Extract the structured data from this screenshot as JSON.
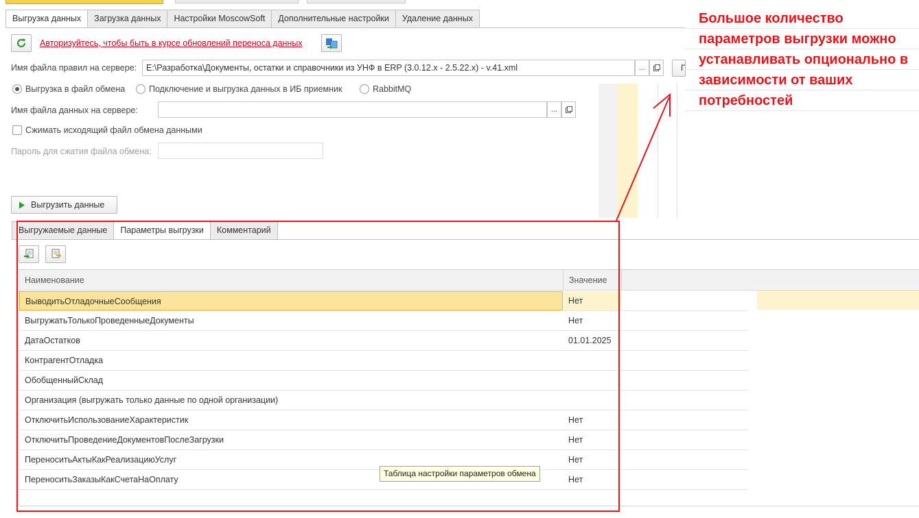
{
  "main_tabs": [
    {
      "label": "Выгрузка данных",
      "active": true
    },
    {
      "label": "Загрузка данных",
      "active": false
    },
    {
      "label": "Настройки MoscowSoft",
      "active": false
    },
    {
      "label": "Дополнительные настройки",
      "active": false
    },
    {
      "label": "Удаление данных",
      "active": false
    }
  ],
  "toolbar": {
    "refresh_icon": "refresh-icon",
    "auth_link": "Авторизуйтесь, чтобы быть в курсе обновлений переноса данных",
    "info_icon": "transfer-icon"
  },
  "rules_file": {
    "label": "Имя файла правил на сервере:",
    "value": "E:\\Разработка\\Документы, остатки и справочники из УНФ в ERP (3.0.12.x - 2.5.22.x) - v.41.xml",
    "browse": "...",
    "extra_button": "П"
  },
  "mode_radios": [
    {
      "label": "Выгрузка в файл обмена",
      "selected": true
    },
    {
      "label": "Подключение и выгрузка данных в ИБ приемник",
      "selected": false
    },
    {
      "label": "RabbitMQ",
      "selected": false
    }
  ],
  "data_file": {
    "label": "Имя файла данных на сервере:",
    "value": "",
    "browse": "..."
  },
  "compress": {
    "label": "Сжимать исходящий файл обмена данными",
    "checked": false
  },
  "password": {
    "label": "Пароль для сжатия файла обмена:",
    "value": ""
  },
  "export_button": "Выгрузить данные",
  "annotation": {
    "lines": [
      "Большое количество",
      "параметров выгрузки можно",
      "устанавливать опционально в",
      "зависимости от ваших",
      "потребностей"
    ],
    "color": "#e8141a"
  },
  "sub_tabs": [
    {
      "label": "Выгружаемые данные",
      "active": false
    },
    {
      "label": "Параметры выгрузки",
      "active": true
    },
    {
      "label": "Комментарий",
      "active": false
    }
  ],
  "params_toolbar": [
    "load-params-icon",
    "save-params-icon"
  ],
  "table": {
    "headers": [
      "Наименование",
      "Значение"
    ],
    "rows": [
      {
        "name": "ВыводитьОтладочныеСообщения",
        "value": "Нет",
        "selected": true
      },
      {
        "name": "ВыгружатьТолькоПроведенныеДокументы",
        "value": "Нет"
      },
      {
        "name": "ДатаОстатков",
        "value": "01.01.2025"
      },
      {
        "name": "КонтрагентОтладка",
        "value": ""
      },
      {
        "name": "ОбобщенныйСклад",
        "value": ""
      },
      {
        "name": "Организация (выгружать только данные по одной организации)",
        "value": ""
      },
      {
        "name": "ОтключитьИспользованиеХарактеристик",
        "value": "Нет"
      },
      {
        "name": "ОтключитьПроведениеДокументовПослеЗагрузки",
        "value": "Нет"
      },
      {
        "name": "ПереноситьАктыКакРеализациюУслуг",
        "value": "Нет"
      },
      {
        "name": "ПереноситьЗаказыКакСчетаНаОплату",
        "value": "Нет"
      }
    ]
  },
  "tooltip": "Таблица настройки параметров обмена"
}
